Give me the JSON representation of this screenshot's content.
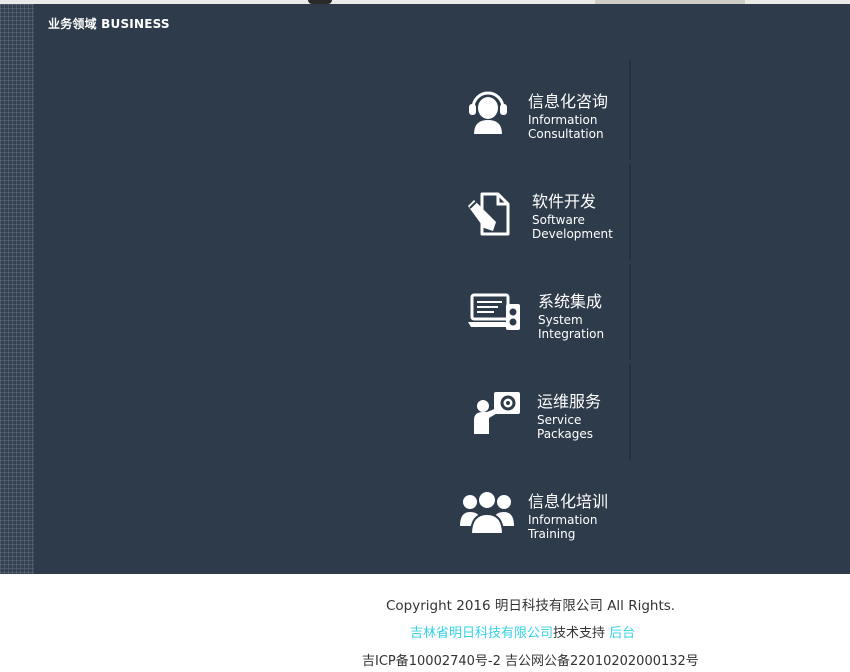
{
  "section": {
    "title": "业务领域 BUSINESS"
  },
  "services": [
    {
      "icon": "headset-person-icon",
      "zh": "信息化咨询",
      "en_line1": "Information",
      "en_line2": "Consultation"
    },
    {
      "icon": "document-pencil-icon",
      "zh": "软件开发",
      "en_line1": "Software",
      "en_line2": "Development"
    },
    {
      "icon": "computer-gear-icon",
      "zh": "系统集成",
      "en_line1": "System",
      "en_line2": "Integration"
    },
    {
      "icon": "presenter-gear-icon",
      "zh": "运维服务",
      "en_line1": "Service",
      "en_line2": "Packages"
    },
    {
      "icon": "group-people-icon",
      "zh": "信息化培训",
      "en_line1": "Information",
      "en_line2": "Training"
    }
  ],
  "footer": {
    "copyright": "Copyright 2016 明日科技有限公司 All Rights.",
    "support_company": "吉林省明日科技有限公司",
    "support_text": "技术支持",
    "support_admin": "后台",
    "icp": "吉ICP备10002740号-2 吉公网公备22010202000132号"
  },
  "colors": {
    "panel": "#2e3b4a",
    "accent_link": "#35d2e8"
  }
}
